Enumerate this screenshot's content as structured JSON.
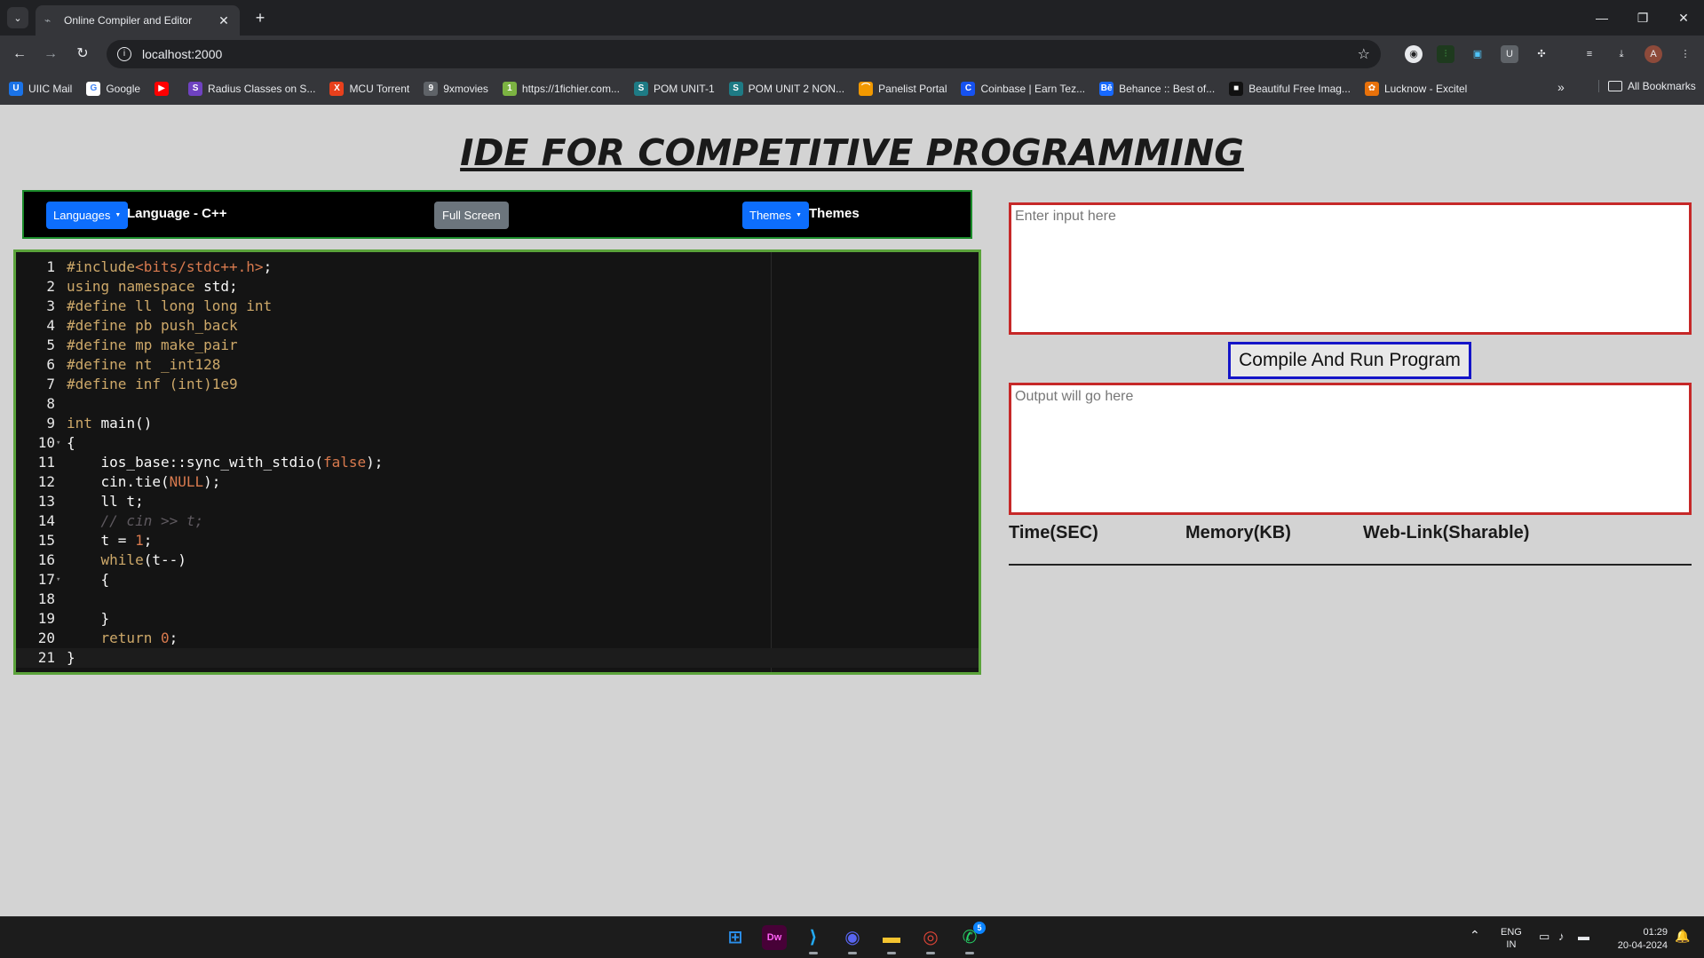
{
  "browser": {
    "tab_title": "Online Compiler and Editor",
    "tab_close": "✕",
    "new_tab": "+",
    "url": "localhost:2000",
    "window_controls": [
      "—",
      "❐",
      "✕"
    ],
    "bookmarks": [
      {
        "label": "UIIC Mail",
        "icon": "uiic-icon",
        "color": "#1a73e8",
        "glyph": "U"
      },
      {
        "label": "Google",
        "icon": "google-icon",
        "color": "#ffffff",
        "glyph": "G"
      },
      {
        "label": "",
        "icon": "youtube-icon",
        "color": "#ff0000",
        "glyph": "▶"
      },
      {
        "label": "Radius Classes on S...",
        "icon": "radius-icon",
        "color": "#6f42c1",
        "glyph": "S"
      },
      {
        "label": "MCU Torrent",
        "icon": "mcu-icon",
        "color": "#e8401c",
        "glyph": "X"
      },
      {
        "label": "9xmovies",
        "icon": "9xmovies-icon",
        "color": "#5f6368",
        "glyph": "9"
      },
      {
        "label": "https://1fichier.com...",
        "icon": "1fichier-icon",
        "color": "#7cb342",
        "glyph": "1"
      },
      {
        "label": "POM UNIT-1",
        "icon": "scribd-icon",
        "color": "#1e7b85",
        "glyph": "S"
      },
      {
        "label": "POM UNIT 2 NON...",
        "icon": "scribd-icon",
        "color": "#1e7b85",
        "glyph": "S"
      },
      {
        "label": "Panelist Portal",
        "icon": "panelist-icon",
        "color": "#f29900",
        "glyph": "⌒"
      },
      {
        "label": "Coinbase | Earn Tez...",
        "icon": "coinbase-icon",
        "color": "#1652f0",
        "glyph": "C"
      },
      {
        "label": "Behance :: Best of...",
        "icon": "behance-icon",
        "color": "#1769ff",
        "glyph": "Bē"
      },
      {
        "label": "Beautiful Free Imag...",
        "icon": "unsplash-icon",
        "color": "#111111",
        "glyph": "■"
      },
      {
        "label": "Lucknow - Excitel",
        "icon": "excitel-icon",
        "color": "#e8710a",
        "glyph": "✿"
      }
    ],
    "bookmarks_more": "»",
    "all_bookmarks": "All Bookmarks"
  },
  "page": {
    "title": "IDE FOR COMPETITIVE PROGRAMMING",
    "languages_btn": "Languages",
    "language_label": "Language - C++",
    "fullscreen_btn": "Full Screen",
    "themes_btn": "Themes",
    "themes_label": "Themes",
    "input_placeholder": "Enter input here",
    "output_placeholder": "Output will go here",
    "run_btn": "Compile And Run Program",
    "stats": [
      "Time(SEC)",
      "Memory(KB)",
      "Web-Link(Sharable)"
    ]
  },
  "editor": {
    "lines": [
      "#include<bits/stdc++.h>;",
      "using namespace std;",
      "#define ll long long int",
      "#define pb push_back",
      "#define mp make_pair",
      "#define nt _int128",
      "#define inf (int)1e9",
      "",
      "int main()",
      "{",
      "    ios_base::sync_with_stdio(false);",
      "    cin.tie(NULL);",
      "    ll t;",
      "    // cin >> t;",
      "    t = 1;",
      "    while(t--)",
      "    {",
      "",
      "    }",
      "    return 0;",
      "}"
    ]
  },
  "taskbar": {
    "apps": [
      {
        "name": "windows-start-icon",
        "glyph": "⊞",
        "color": "#2b8fea"
      },
      {
        "name": "dreamweaver-icon",
        "glyph": "Dw",
        "color": "#470137"
      },
      {
        "name": "vscode-icon",
        "glyph": "⟩",
        "color": "#23a9f2"
      },
      {
        "name": "discord-icon",
        "glyph": "◉",
        "color": "#5865f2"
      },
      {
        "name": "file-explorer-icon",
        "glyph": "▬",
        "color": "#f4c430"
      },
      {
        "name": "chrome-icon",
        "glyph": "◎",
        "color": "#db4437"
      },
      {
        "name": "whatsapp-icon",
        "glyph": "✆",
        "color": "#25d366"
      }
    ],
    "whatsapp_badge": "5",
    "lang_top": "ENG",
    "lang_bottom": "IN",
    "time": "01:29",
    "date": "20-04-2024"
  }
}
